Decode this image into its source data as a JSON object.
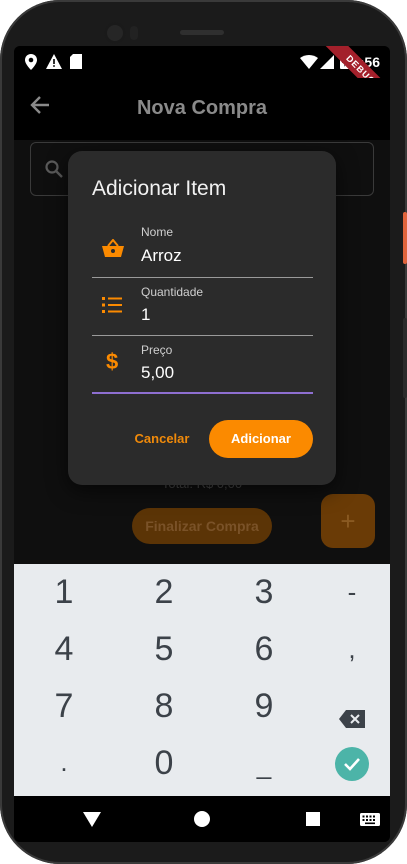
{
  "status_bar": {
    "time": "9:56",
    "debug_label": "DEBUG",
    "icons": [
      "location-icon",
      "warning-icon",
      "sd-card-icon",
      "wifi-icon",
      "signal-icon",
      "battery-icon"
    ]
  },
  "app_bar": {
    "title": "Nova Compra"
  },
  "background": {
    "finalize_label": "Finalizar Compra",
    "total_text": "Total: R$ 0,00",
    "fab_label": "+"
  },
  "dialog": {
    "title": "Adicionar Item",
    "fields": [
      {
        "label": "Nome",
        "value": "Arroz",
        "icon": "basket-icon"
      },
      {
        "label": "Quantidade",
        "value": "1",
        "icon": "list-icon"
      },
      {
        "label": "Preço",
        "value": "5,00",
        "icon": "dollar-icon"
      }
    ],
    "cancel_label": "Cancelar",
    "add_label": "Adicionar"
  },
  "keyboard": {
    "keys": [
      "1",
      "2",
      "3",
      "-",
      "4",
      "5",
      "6",
      ",",
      "7",
      "8",
      "9",
      "⌫",
      ".",
      "0",
      "_",
      "✓"
    ]
  },
  "colors": {
    "accent": "#fb8a00",
    "focus_line": "#8e6fd1",
    "dialog_bg": "#2b2b2b",
    "keyboard_bg": "#e8ebee",
    "done_key": "#4cb4a8"
  }
}
